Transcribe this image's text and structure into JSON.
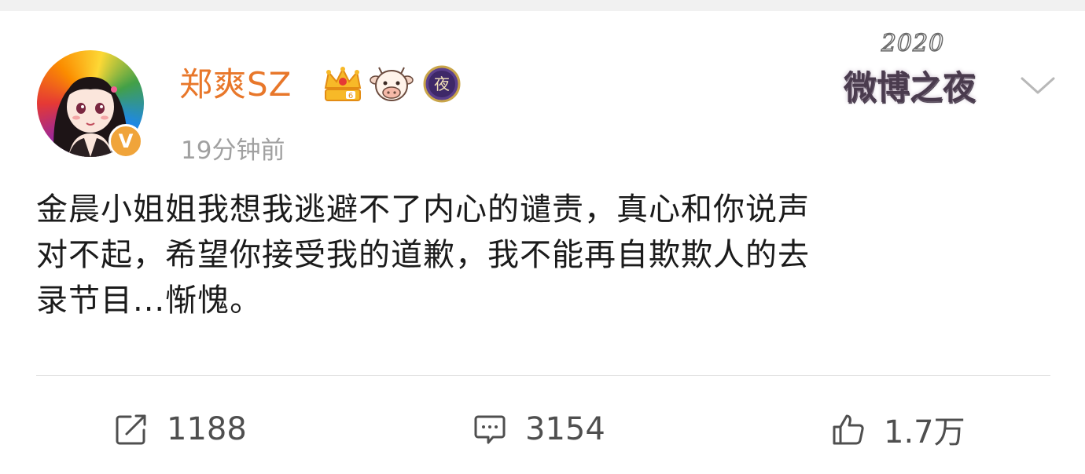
{
  "post": {
    "username": "郑爽SZ",
    "timestamp": "19分钟前",
    "verified_mark": "V",
    "night_badge_text": "夜",
    "event_logo": {
      "year": "2020",
      "name": "微博之夜"
    },
    "content_lines": [
      "金晨小姐姐我想我逃避不了内心的谴责，真心和你说声",
      "对不起，希望你接受我的道歉，我不能再自欺欺人的去",
      "录节目...惭愧。"
    ],
    "actions": {
      "repost_count": "1188",
      "comment_count": "3154",
      "like_count": "1.7万"
    }
  },
  "colors": {
    "username": "#e8772a",
    "timestamp": "#a0a0a0",
    "content_text": "#1b1b1b",
    "action_text": "#4f4f4f",
    "verified_badge": "#f0a43a"
  },
  "icons": [
    "avatar",
    "verified-icon",
    "crown-vip-icon",
    "cow-badge-icon",
    "night-badge-icon",
    "event-logo",
    "chevron-down-icon",
    "repost-icon",
    "comment-icon",
    "like-icon"
  ]
}
